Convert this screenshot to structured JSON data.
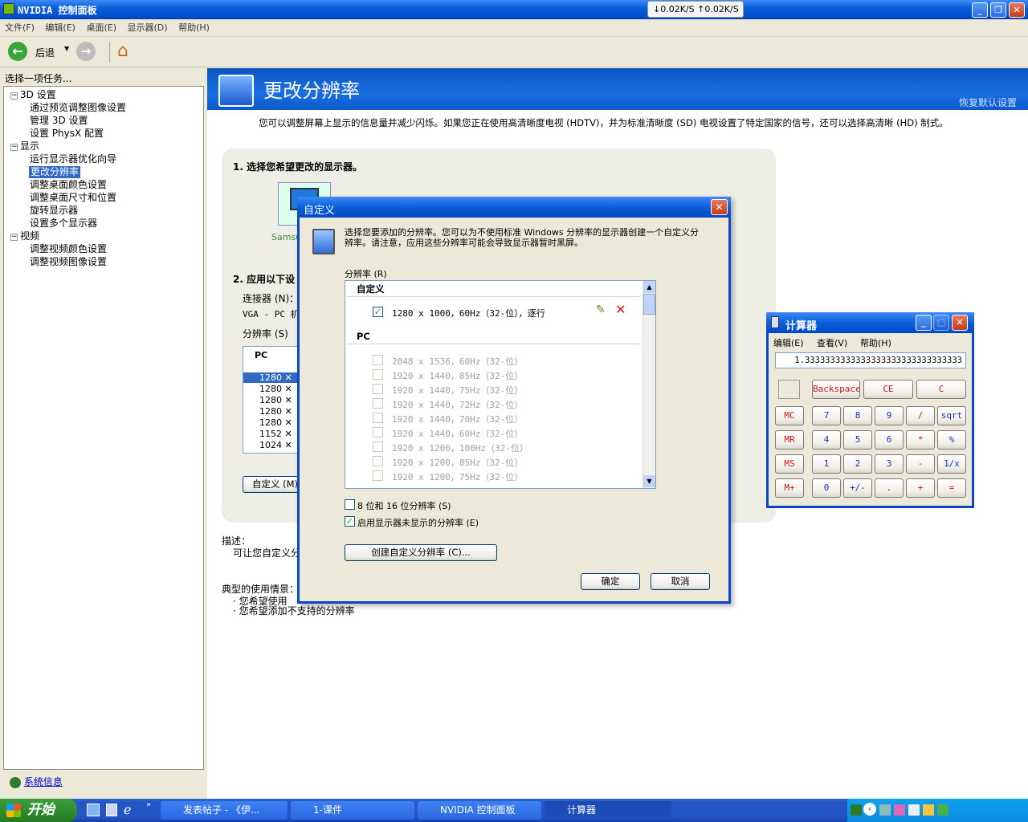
{
  "window": {
    "title": "NVIDIA 控制面板",
    "netspeed": "↓0.02K/S ↑0.02K/S"
  },
  "menu": [
    "文件(F)",
    "编辑(E)",
    "桌面(E)",
    "显示器(D)",
    "帮助(H)"
  ],
  "toolbar": {
    "back_label": "后退"
  },
  "left": {
    "header": "选择一项任务...",
    "tree": [
      {
        "label": "3D 设置",
        "level": 0,
        "toggle": "-"
      },
      {
        "label": "通过预览调整图像设置",
        "level": 1
      },
      {
        "label": "管理 3D 设置",
        "level": 1
      },
      {
        "label": "设置 PhysX 配置",
        "level": 1
      },
      {
        "label": "显示",
        "level": 0,
        "toggle": "-"
      },
      {
        "label": "运行显示器优化向导",
        "level": 1
      },
      {
        "label": "更改分辨率",
        "level": 1,
        "selected": true
      },
      {
        "label": "调整桌面颜色设置",
        "level": 1
      },
      {
        "label": "调整桌面尺寸和位置",
        "level": 1
      },
      {
        "label": "旋转显示器",
        "level": 1
      },
      {
        "label": "设置多个显示器",
        "level": 1
      },
      {
        "label": "视频",
        "level": 0,
        "toggle": "-"
      },
      {
        "label": "调整视频颜色设置",
        "level": 1
      },
      {
        "label": "调整视频图像设置",
        "level": 1
      }
    ],
    "sysinfo": "系统信息"
  },
  "main": {
    "title": "更改分辨率",
    "restore": "恢复默认设置",
    "intro": "您可以调整屏幕上显示的信息量并减少闪烁。如果您正在使用高清晰度电视 (HDTV)，并为标准清晰度 (SD) 电视设置了特定国家的信号，还可以选择高清晰 (HD) 制式。",
    "step1": "1. 选择您希望更改的显示器。",
    "monitor_label": "Samsu",
    "step2": "2. 应用以下设",
    "connector_label": "连接器 (N)：",
    "connector_value": "VGA - PC 机",
    "resolution_label": "分辨率 (S)",
    "res_header": "PC",
    "res_rows": [
      "1280",
      "1280",
      "1280",
      "1280",
      "1280",
      "1152",
      "1024"
    ],
    "custom_button": "自定义 (M)...",
    "desc_label": "描述：",
    "desc_text": "可让您自定义分",
    "usage_label": "典型的使用情景：",
    "usage_items": [
      "您希望使用",
      "您希望添加不支持的分辨率"
    ]
  },
  "dialog": {
    "title": "自定义",
    "info": "选择您要添加的分辨率。您可以为不使用标准 Windows 分辨率的显示器创建一个自定义分辨率。请注意，应用这些分辨率可能会导致显示器暂时黑屏。",
    "res_label": "分辨率 (R)",
    "group_custom": "自定义",
    "custom_item": "1280 x 1000，60Hz（32-位），逐行",
    "group_pc": "PC",
    "pc_items": [
      "2048 x 1536，60Hz（32-位）",
      "1920 x 1440，85Hz（32-位）",
      "1920 x 1440，75Hz（32-位）",
      "1920 x 1440，72Hz（32-位）",
      "1920 x 1440，70Hz（32-位）",
      "1920 x 1440，60Hz（32-位）",
      "1920 x 1200，100Hz（32-位）",
      "1920 x 1200，85Hz（32-位）",
      "1920 x 1200，75Hz（32-位）"
    ],
    "opt1": "8 位和 16 位分辨率 (S)",
    "opt2": "启用显示器未显示的分辨率 (E)",
    "create_btn": "创建自定义分辨率 (C)...",
    "ok": "确定",
    "cancel": "取消"
  },
  "calc": {
    "title": "计算器",
    "menu": [
      "编辑(E)",
      "查看(V)",
      "帮助(H)"
    ],
    "display": "1.3333333333333333333333333333333",
    "row0": [
      "Backspace",
      "CE",
      "C"
    ],
    "mem": [
      "MC",
      "MR",
      "MS",
      "M+"
    ],
    "grid": [
      [
        "7",
        "8",
        "9",
        "/",
        "sqrt"
      ],
      [
        "4",
        "5",
        "6",
        "*",
        "%"
      ],
      [
        "1",
        "2",
        "3",
        "-",
        "1/x"
      ],
      [
        "0",
        "+/-",
        ".",
        "+",
        "="
      ]
    ]
  },
  "taskbar": {
    "start": "开始",
    "tasks": [
      "发表帖子 - 《伊...",
      "1-课件",
      "NVIDIA 控制面板",
      "计算器"
    ]
  }
}
